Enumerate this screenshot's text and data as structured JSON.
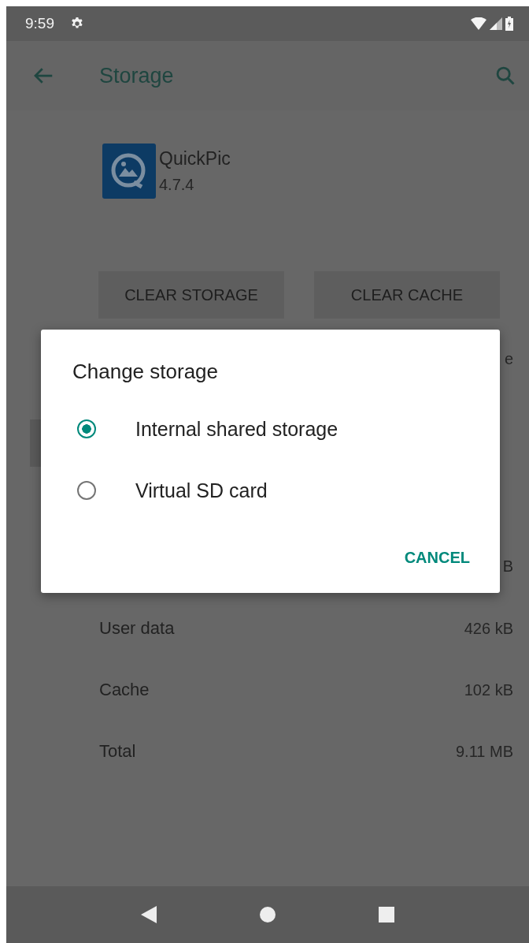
{
  "status_bar": {
    "time": "9:59"
  },
  "app_bar": {
    "title": "Storage"
  },
  "app": {
    "name": "QuickPic",
    "version": "4.7.4"
  },
  "buttons": [
    "CLEAR STORAGE",
    "CLEAR CACHE"
  ],
  "covered_rows": [
    {
      "value": "e"
    },
    {
      "value": "B"
    }
  ],
  "storage_rows": [
    {
      "label": "User data",
      "value": "426 kB"
    },
    {
      "label": "Cache",
      "value": "102 kB"
    },
    {
      "label": "Total",
      "value": "9.11 MB"
    }
  ],
  "dialog": {
    "title": "Change storage",
    "options": [
      {
        "label": "Internal shared storage",
        "selected": true
      },
      {
        "label": "Virtual SD card",
        "selected": false
      }
    ],
    "action": "CANCEL"
  }
}
